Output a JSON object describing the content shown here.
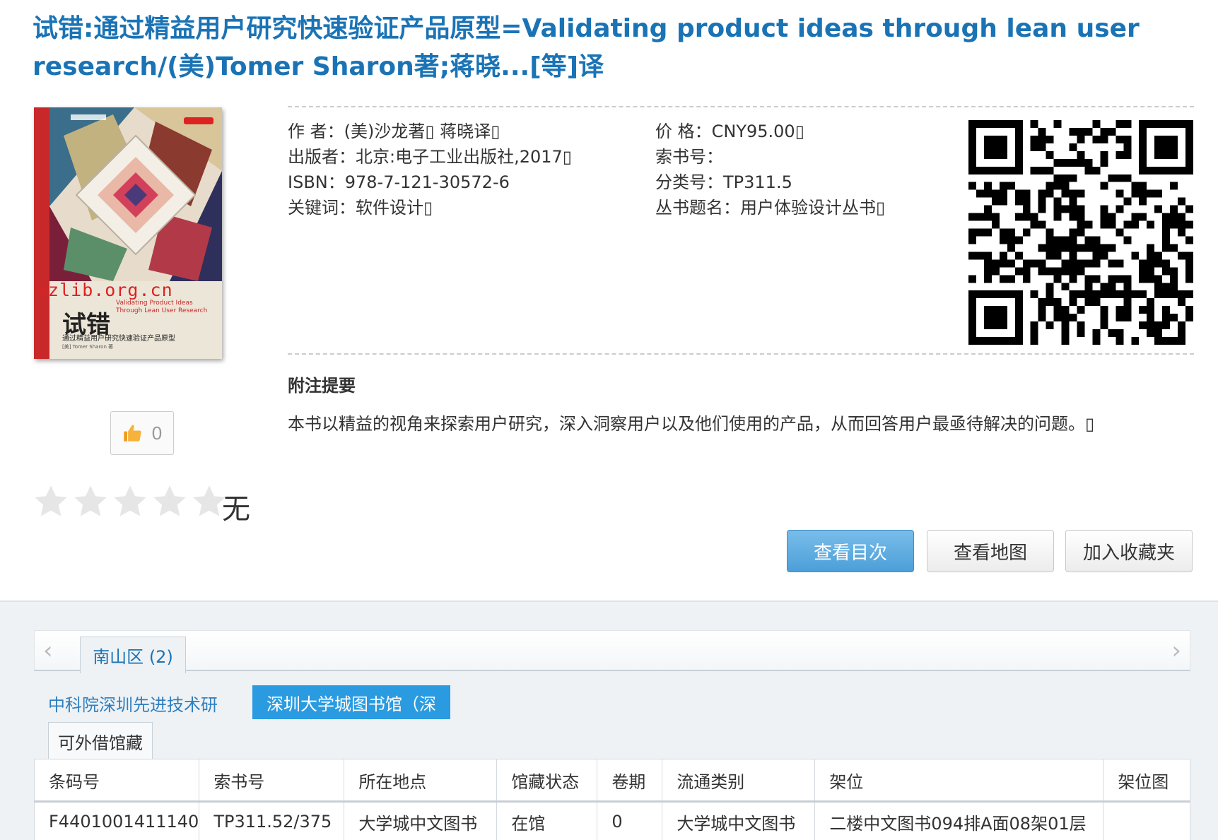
{
  "title": "试错:通过精益用户研究快速验证产品原型=Validating product ideas through lean user research/(美)Tomer Sharon著;蒋晓...[等]译",
  "cover": {
    "watermark": "szlib.org.cn",
    "title_cn": "试错",
    "title_en": "Validating Product Ideas",
    "title_en_sub": "Through Lean User Research",
    "subtitle": "通过精益用户研究快速验证产品原型",
    "spine": "试错 通过精益用户研究快速验证产品原型",
    "meta": "[美] Tomer Sharon 著"
  },
  "like": {
    "count": "0",
    "icon": "thumbs-up-icon"
  },
  "rating": {
    "stars": 5,
    "filled": 0,
    "text": "无"
  },
  "meta": {
    "left": [
      "作 者：(美)沙龙著▯ 蒋晓译▯",
      "出版者：北京:电子工业出版社,2017▯",
      "ISBN：978-7-121-30572-6",
      "关键词：软件设计▯"
    ],
    "right": [
      "价 格：CNY95.00▯",
      "索书号：",
      "分类号：TP311.5",
      "丛书题名：用户体验设计丛书▯"
    ]
  },
  "summary": {
    "heading": "附注提要",
    "text": "本书以精益的视角来探索用户研究，深入洞察用户以及他们使用的产品，从而回答用户最亟待解决的问题。▯"
  },
  "actions": {
    "toc": "查看目次",
    "map": "查看地图",
    "favorite": "加入收藏夹"
  },
  "tabs": {
    "prev": "‹",
    "next": "›",
    "active": "南山区 (2)"
  },
  "libraries": {
    "link": "中科院深圳先进技术研",
    "active": "深圳大学城图书馆（深"
  },
  "subtab": "可外借馆藏",
  "holdings": {
    "headers": [
      "条码号",
      "索书号",
      "所在地点",
      "馆藏状态",
      "卷期",
      "流通类别",
      "架位",
      "架位图"
    ],
    "rows": [
      [
        "F4401001411140",
        "TP311.52/375",
        "大学城中文图书",
        "在馆",
        "0",
        "大学城中文图书",
        "二楼中文图书094排A面08架01层",
        ""
      ]
    ]
  },
  "colors": {
    "title": "#1a73b5",
    "primary_button": "#4c9fd9",
    "active_library": "#2a9be0",
    "lower_bg": "#eef2f5"
  }
}
